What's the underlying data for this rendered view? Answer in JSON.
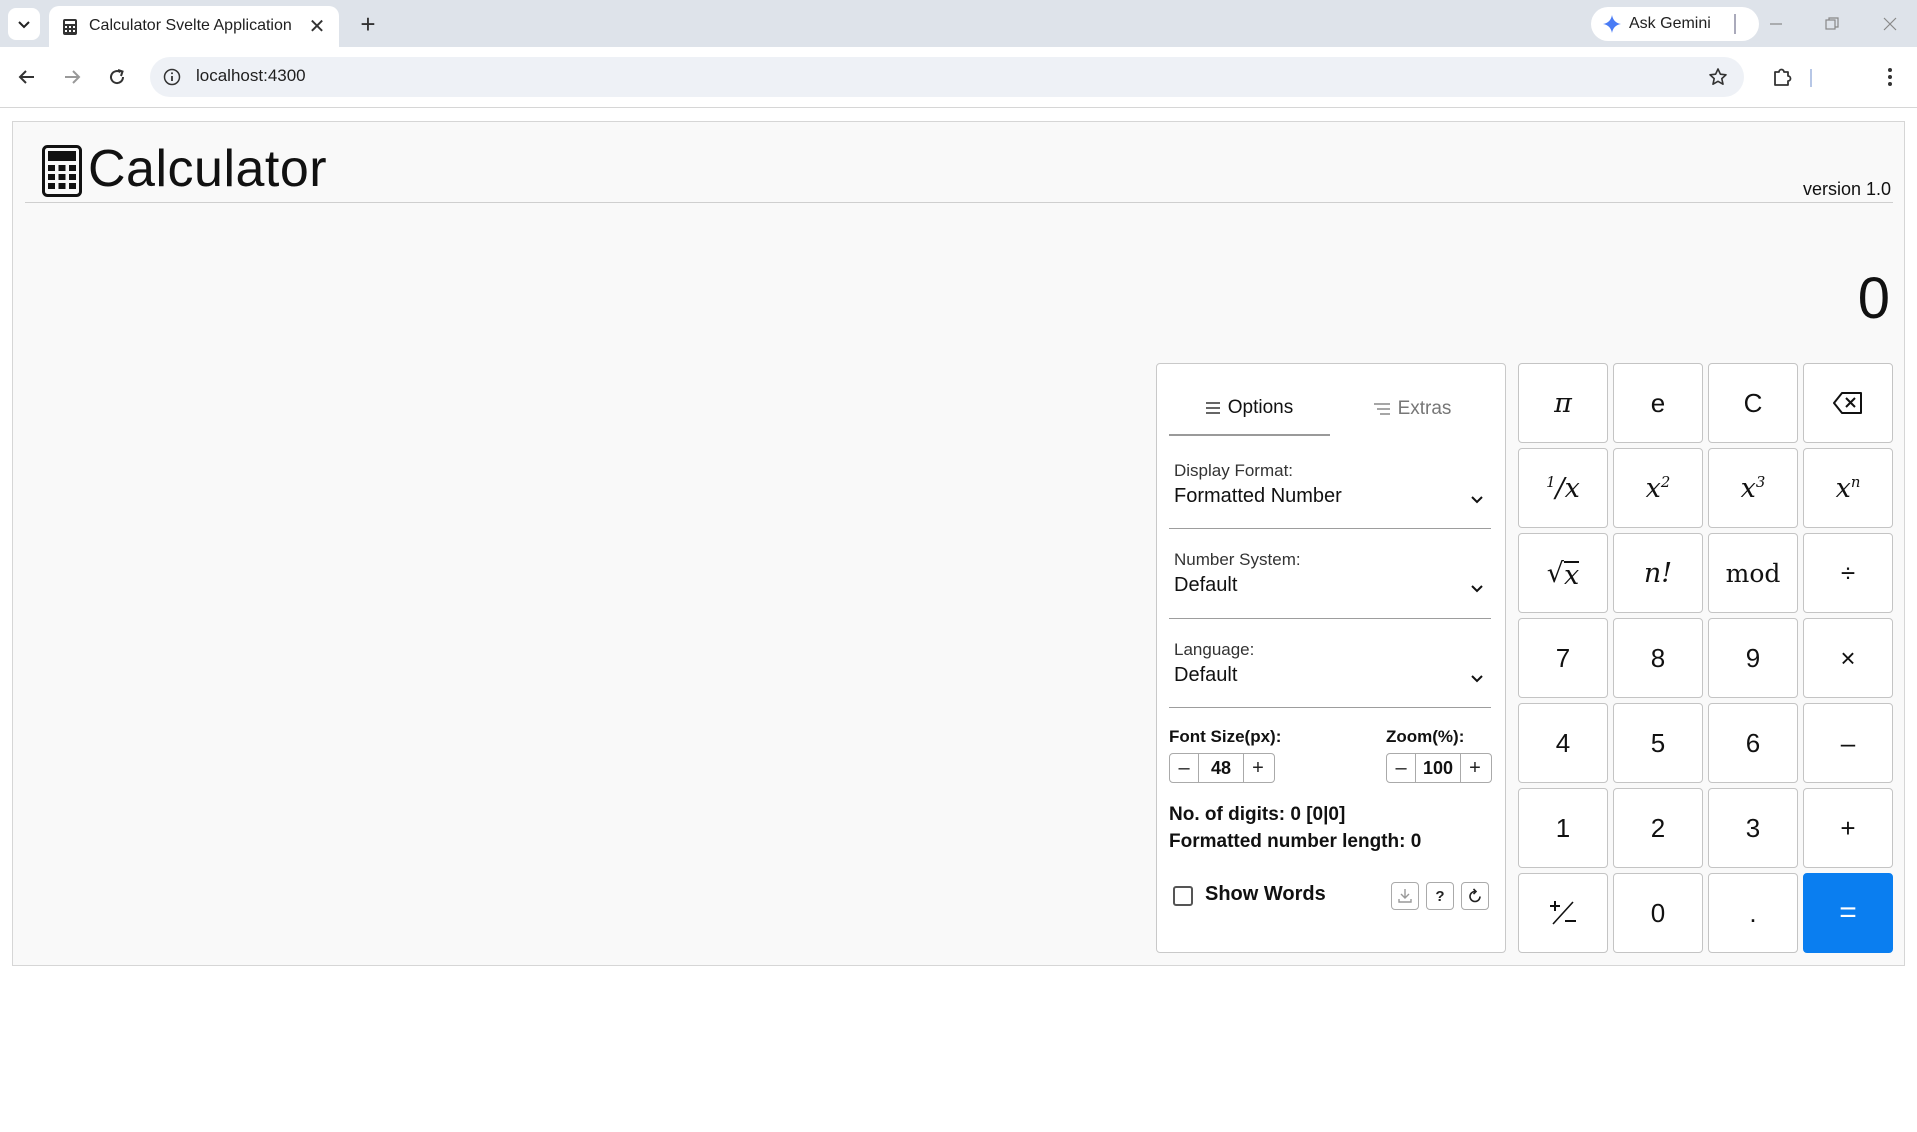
{
  "browser": {
    "tab_title": "Calculator Svelte Application",
    "new_tab_symbol": "+",
    "close_symbol": "✕",
    "ask_gemini": "Ask Gemini",
    "url": "localhost:4300"
  },
  "app": {
    "title": "Calculator",
    "version": "version 1.0",
    "display_value": "0"
  },
  "options": {
    "tabs": [
      "Options",
      "Extras"
    ],
    "display_format": {
      "label": "Display Format:",
      "value": "Formatted Number"
    },
    "number_system": {
      "label": "Number System:",
      "value": "Default"
    },
    "language": {
      "label": "Language:",
      "value": "Default"
    },
    "font_size": {
      "label": "Font Size(px):",
      "value": "48",
      "minus": "–",
      "plus": "+"
    },
    "zoom": {
      "label": "Zoom(%):",
      "value": "100",
      "minus": "–",
      "plus": "+"
    },
    "digits_info": "No. of digits: 0 [0|0]",
    "length_info": "Formatted number length: 0",
    "show_words": {
      "label": "Show Words",
      "checked": false
    },
    "help_label": "?"
  },
  "keypad": {
    "pi": "π",
    "e": "e",
    "clear": "C",
    "sqrt_x": "x",
    "factorial": "n!",
    "mod": "mod",
    "divide": "÷",
    "seven": "7",
    "eight": "8",
    "nine": "9",
    "multiply": "×",
    "four": "4",
    "five": "5",
    "six": "6",
    "minus": "–",
    "one": "1",
    "two": "2",
    "three": "3",
    "plus": "+",
    "zero": "0",
    "decimal": ".",
    "equals": "="
  },
  "colors": {
    "accent": "#0a7ef0",
    "tabbar": "#dee3ea"
  }
}
